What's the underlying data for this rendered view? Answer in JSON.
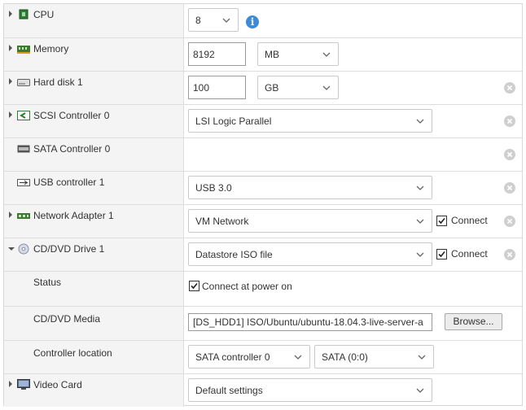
{
  "rows": {
    "cpu": {
      "label": "CPU",
      "value": "8"
    },
    "memory": {
      "label": "Memory",
      "value": "8192",
      "unit": "MB"
    },
    "harddisk": {
      "label": "Hard disk 1",
      "value": "100",
      "unit": "GB"
    },
    "scsi": {
      "label": "SCSI Controller 0",
      "value": "LSI Logic Parallel"
    },
    "sata": {
      "label": "SATA Controller 0"
    },
    "usb": {
      "label": "USB controller 1",
      "value": "USB 3.0"
    },
    "network": {
      "label": "Network Adapter 1",
      "value": "VM Network",
      "connect_label": "Connect",
      "connected": true
    },
    "cddvd": {
      "label": "CD/DVD Drive 1",
      "value": "Datastore ISO file",
      "connect_label": "Connect",
      "connected": true
    },
    "status": {
      "label": "Status",
      "option_label": "Connect at power on",
      "checked": true
    },
    "media": {
      "label": "CD/DVD Media",
      "value": "[DS_HDD1] ISO/Ubuntu/ubuntu-18.04.3-live-server-a",
      "browse_label": "Browse..."
    },
    "controller": {
      "label": "Controller location",
      "controller": "SATA controller 0",
      "port": "SATA (0:0)"
    },
    "video": {
      "label": "Video Card",
      "value": "Default settings"
    }
  },
  "icons": {
    "cpu": "cpu-chip-icon",
    "memory": "memory-module-icon",
    "harddisk": "hard-disk-icon",
    "scsi": "scsi-controller-icon",
    "sata": "sata-controller-icon",
    "usb": "usb-icon",
    "network": "network-adapter-icon",
    "cddvd": "cd-dvd-icon",
    "video": "monitor-icon",
    "info": "info-icon",
    "remove": "remove-circle-icon"
  },
  "colors": {
    "info_blue": "#3d8bd8",
    "label_bg": "#f4f4f4",
    "border": "#dddddd"
  }
}
